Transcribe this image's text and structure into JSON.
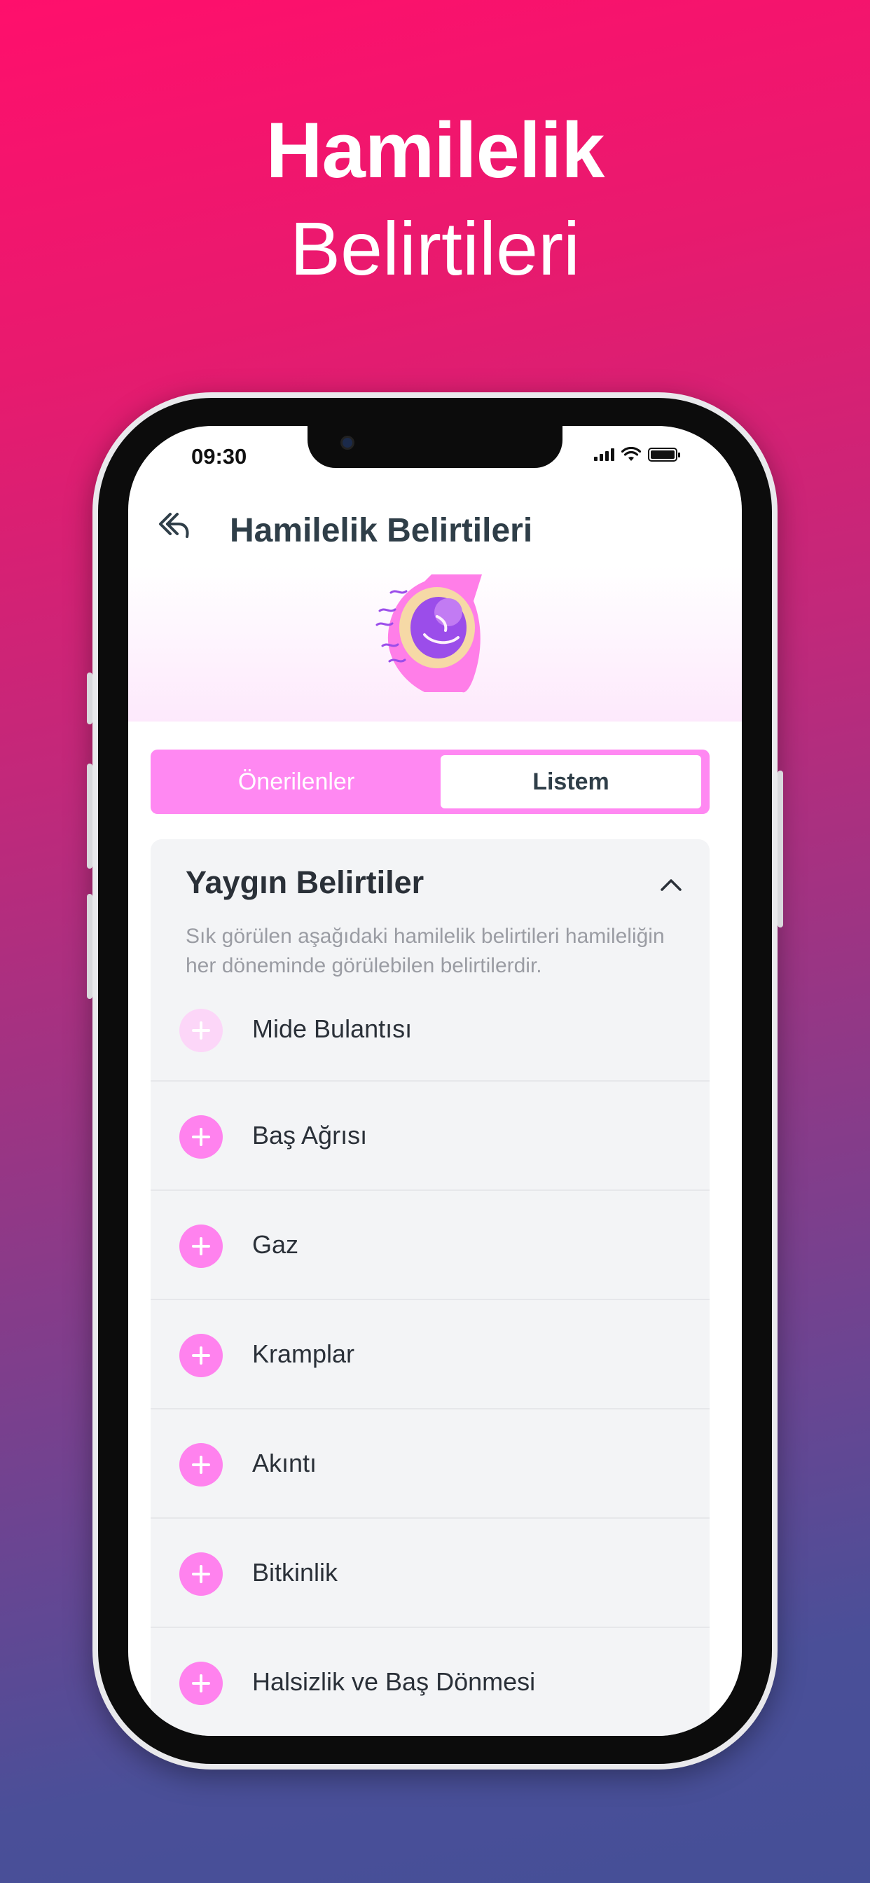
{
  "promo": {
    "title_line1": "Hamilelik",
    "title_line2": "Belirtileri"
  },
  "status_bar": {
    "time": "09:30"
  },
  "header": {
    "title": "Hamilelik Belirtileri",
    "back_icon": "back-arrow-icon"
  },
  "tabs": {
    "left_label": "Önerilenler",
    "right_label": "Listem",
    "selected": "Listem"
  },
  "section": {
    "title": "Yaygın Belirtiler",
    "description": "Sık görülen aşağıdaki hamilelik belirtileri hamileliğin her döneminde görülebilen belirtilerdir.",
    "expanded": true,
    "items": [
      {
        "label": "Mide Bulantısı"
      },
      {
        "label": "Baş Ağrısı"
      },
      {
        "label": "Gaz"
      },
      {
        "label": "Kramplar"
      },
      {
        "label": "Akıntı"
      },
      {
        "label": "Bitkinlik"
      },
      {
        "label": "Halsizlik ve Baş Dönmesi"
      }
    ]
  },
  "colors": {
    "accent_pink": "#ff82ee",
    "title_text": "#2f3e48",
    "card_bg": "#f3f4f6"
  }
}
